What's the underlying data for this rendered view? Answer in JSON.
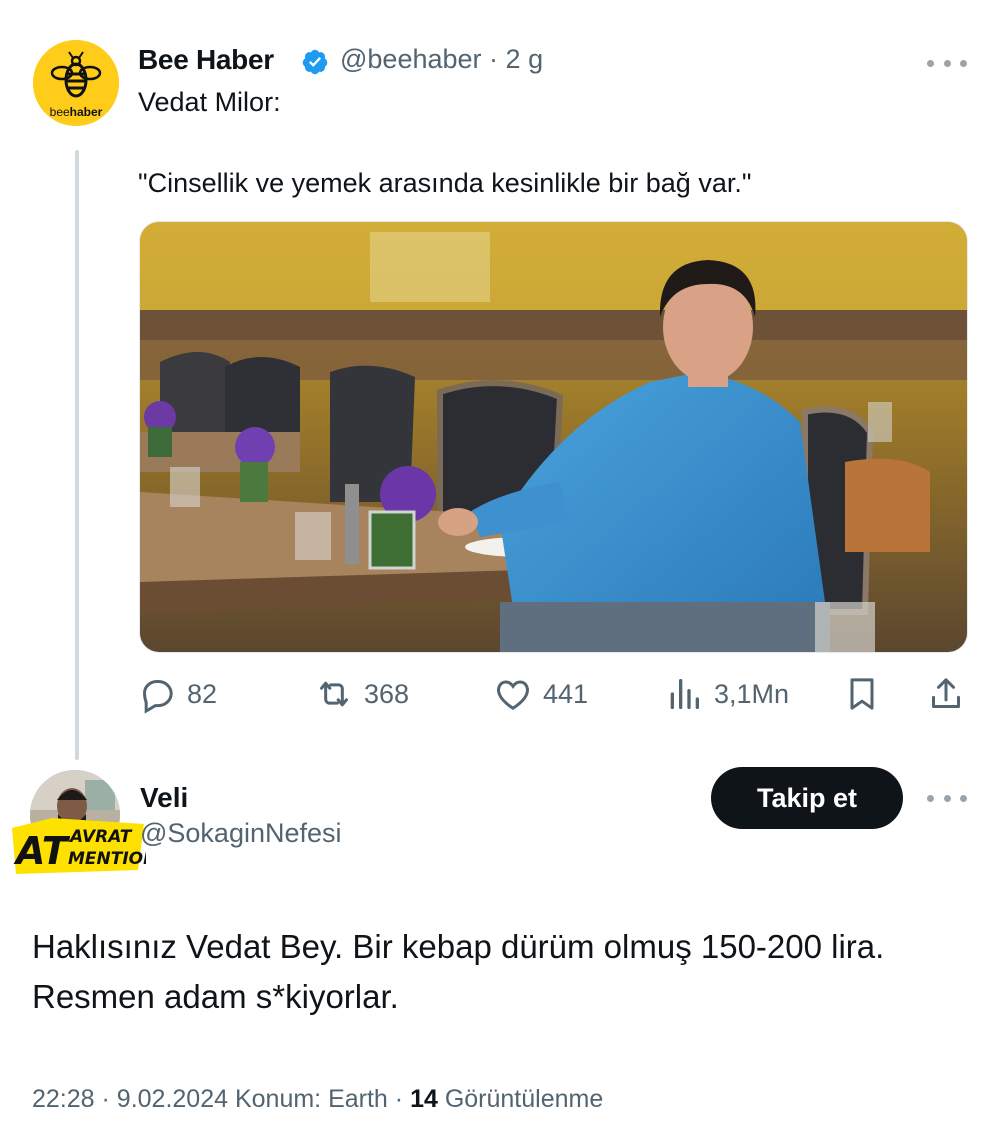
{
  "tweet": {
    "avatar_logo": "beehaber",
    "author_name": "Bee Haber",
    "verified": true,
    "handle": "@beehaber",
    "separator": "·",
    "age": "2 g",
    "text_line1": "Vedat Milor:",
    "text_quote": "\"Cinsellik ve yemek arasında kesinlikle bir bağ var.\"",
    "actions": {
      "replies": "82",
      "retweets": "368",
      "likes": "441",
      "views": "3,1Mn"
    }
  },
  "reply": {
    "author_name": "Veli",
    "handle": "@SokaginNefesi",
    "avatar_overlay_text": [
      "AT",
      "AVRAT",
      "MENTION"
    ],
    "follow_label": "Takip et",
    "text": "Haklısınız Vedat Bey. Bir kebap dürüm olmuş 150-200 lira. Resmen adam s*kiyorlar.",
    "time": "22:28",
    "date": "9.02.2024",
    "location": "Konum: Earth",
    "views_count": "14",
    "views_label": "Görüntülenme"
  },
  "colors": {
    "text": "#0f1419",
    "muted": "#536471",
    "verified": "#1d9bf0",
    "bee_yellow": "#ffcc1a",
    "follow_bg": "#0f1419"
  },
  "icons": [
    "more-icon",
    "verified-badge-icon",
    "reply-icon",
    "retweet-icon",
    "like-icon",
    "views-icon",
    "bookmark-icon",
    "share-icon"
  ]
}
